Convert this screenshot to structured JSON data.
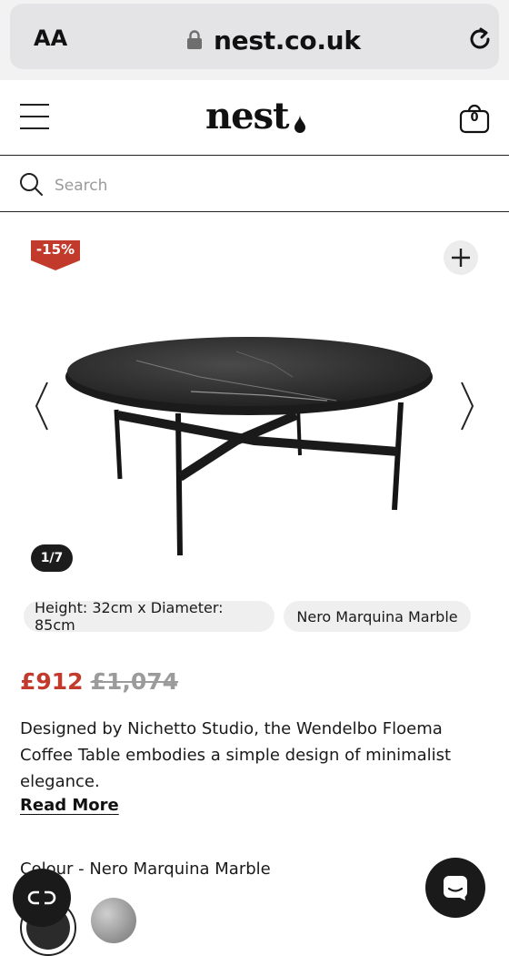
{
  "browser": {
    "text_size_label": "AA",
    "url": "nest.co.uk",
    "icons": [
      "lock-icon",
      "reload-icon"
    ]
  },
  "header": {
    "logo": "nest",
    "bag_count": "0",
    "icons": [
      "menu-icon",
      "bag-icon"
    ]
  },
  "search": {
    "placeholder": "Search",
    "value": ""
  },
  "product": {
    "discount_badge": "-15%",
    "image_counter": "1/7",
    "specs": [
      "Height: 32cm x Diameter: 85cm",
      "Nero Marquina Marble"
    ],
    "price_now": "£912",
    "price_was": "£1,074",
    "description": "Designed by Nichetto Studio, the Wendelbo Floema Coffee Table embodies a simple design of minimalist elegance.",
    "read_more": "Read More",
    "colour_heading": "Colour - Nero Marquina Marble"
  },
  "colors": {
    "sale": "#c23a2b",
    "dark": "#1a1a1a",
    "chip_bg": "#efefef"
  }
}
